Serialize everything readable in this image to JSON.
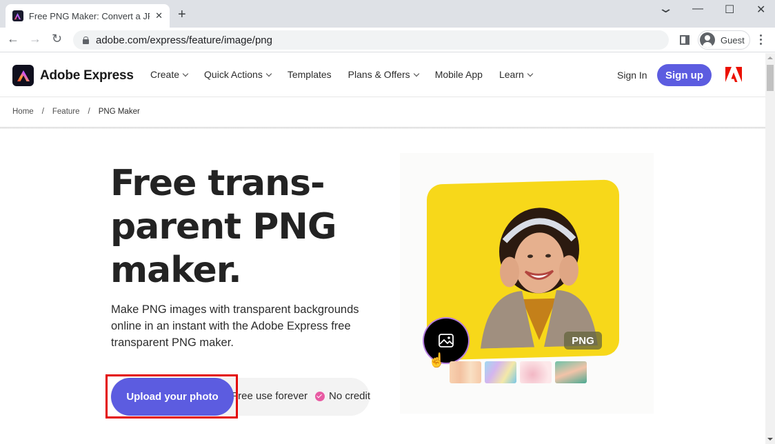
{
  "browser": {
    "tab_title": "Free PNG Maker: Convert a JPG",
    "tab_close": "✕",
    "new_tab": "+",
    "url": "adobe.com/express/feature/image/png",
    "profile_label": "Guest",
    "window_controls": {
      "tab_search": "⌄",
      "minimize": "—",
      "maximize": "☐",
      "close": "✕"
    },
    "nav": {
      "back": "←",
      "forward": "→",
      "reload": "↻"
    }
  },
  "site": {
    "brand_name": "Adobe Express",
    "nav_items": [
      {
        "label": "Create",
        "has_dropdown": true
      },
      {
        "label": "Quick Actions",
        "has_dropdown": true
      },
      {
        "label": "Templates",
        "has_dropdown": false
      },
      {
        "label": "Plans & Offers",
        "has_dropdown": true
      },
      {
        "label": "Mobile App",
        "has_dropdown": false
      },
      {
        "label": "Learn",
        "has_dropdown": true
      }
    ],
    "sign_in": "Sign In",
    "sign_up": "Sign up",
    "accent_color": "#5c5ce0"
  },
  "breadcrumb": [
    {
      "label": "Home"
    },
    {
      "label": "Feature"
    },
    {
      "label": "PNG Maker"
    }
  ],
  "hero": {
    "title_lines": [
      "Free trans-",
      "parent PNG",
      "maker."
    ],
    "subtitle": "Make PNG images with transparent backgrounds online in an instant with the Adobe Express free transparent PNG maker.",
    "cta_label": "Upload your photo",
    "bullets": [
      "Free use forever",
      "No credit card required"
    ],
    "image_badge": "PNG"
  }
}
